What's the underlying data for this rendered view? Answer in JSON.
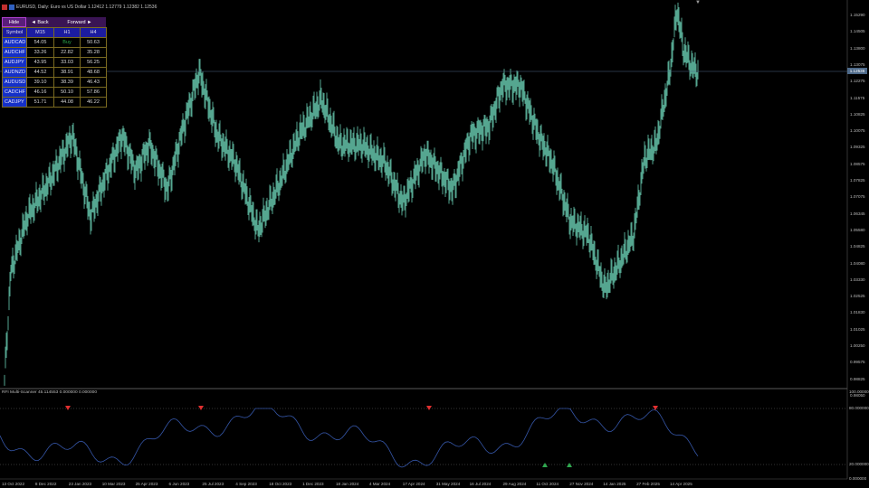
{
  "window": {
    "symbol_title": "EURUSD, Daily:  Euro vs US Dollar  1.12412  1.12779  1.12382  1.12536"
  },
  "scanner": {
    "nav": {
      "hide": "Hide",
      "back": "◄ Back",
      "forward": "Forward ►"
    },
    "headers": [
      "Symbol",
      "M15",
      "H1",
      "H4"
    ],
    "rows": [
      {
        "symbol": "AUDCAD",
        "m15": "54.05",
        "h1": "Buy",
        "h4": "50.63"
      },
      {
        "symbol": "AUDCHF",
        "m15": "33.26",
        "h1": "22.82",
        "h4": "35.28"
      },
      {
        "symbol": "AUDJPY",
        "m15": "43.95",
        "h1": "33.03",
        "h4": "56.25"
      },
      {
        "symbol": "AUDNZD",
        "m15": "44.52",
        "h1": "38.91",
        "h4": "48.68"
      },
      {
        "symbol": "AUDUSD",
        "m15": "39.10",
        "h1": "38.39",
        "h4": "46.43"
      },
      {
        "symbol": "CADCHF",
        "m15": "46.16",
        "h1": "50.10",
        "h4": "57.86"
      },
      {
        "symbol": "CADJPY",
        "m15": "51.71",
        "h1": "44.08",
        "h4": "46.22"
      }
    ],
    "colors": {
      "symbol_bg": "#1530c8",
      "header_bg": "#1c1ca0",
      "buy": "#2aa84a",
      "grid": "#7a6a20"
    }
  },
  "price_axis": {
    "labels": [
      "1.15290",
      "1.14505",
      "1.13800",
      "1.13075",
      "1.12275",
      "1.11575",
      "1.10825",
      "1.10075",
      "1.09325",
      "1.08575",
      "1.07825",
      "1.07075",
      "1.06345",
      "1.05580",
      "1.04825",
      "1.04080",
      "1.03330",
      "1.02525",
      "1.01830",
      "1.01025",
      "1.00250",
      "0.99575",
      "0.98825",
      "0.98050"
    ],
    "current_price": "1.12536"
  },
  "rsi_panel": {
    "title": "RFI Multi-Scanner 45.114553 0.000000 0.000000",
    "axis_labels": [
      "100.000000",
      "80.000000",
      "20.000000",
      "0.000000"
    ]
  },
  "time_axis": {
    "labels": [
      "13 Oct 2022",
      "8 Dec 2022",
      "23 Jan 2023",
      "10 Mar 2023",
      "25 Apr 2023",
      "6 Jun 2023",
      "25 Jul 2023",
      "4 Sep 2023",
      "18 Oct 2023",
      "1 Dec 2023",
      "18 Jan 2024",
      "4 Mar 2024",
      "17 Apr 2024",
      "31 May 2024",
      "16 Jul 2024",
      "29 Aug 2024",
      "11 Oct 2024",
      "27 Nov 2024",
      "14 Jan 2025",
      "27 Feb 2025",
      "14 Apr 2025"
    ]
  },
  "colors": {
    "candles": "#5fb8a0",
    "rsi_line": "#3556a8",
    "sell_arrow": "#e03030",
    "buy_arrow": "#2fa84f",
    "grid_line": "#5a6a7a"
  }
}
